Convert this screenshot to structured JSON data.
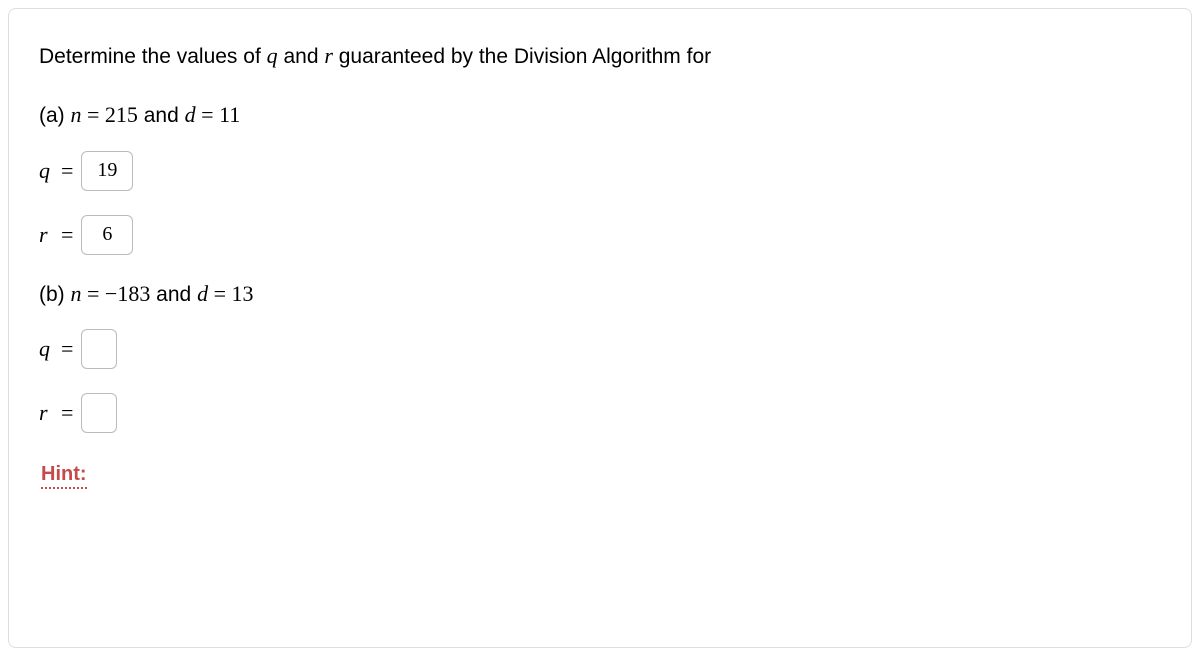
{
  "prompt": {
    "prefix": "Determine the values of ",
    "var_q": "q",
    "and1": " and ",
    "var_r": "r",
    "suffix": " guaranteed by the Division Algorithm for"
  },
  "partA": {
    "label": "(a) ",
    "var_n": "n",
    "eq1": " = ",
    "n_val": "215",
    "and_text": " and ",
    "var_d": "d",
    "eq2": " = ",
    "d_val": "11",
    "q_label": "q",
    "q_equals": "=",
    "q_value": "19",
    "r_label": "r",
    "r_equals": "=",
    "r_value": "6"
  },
  "partB": {
    "label": "(b) ",
    "var_n": "n",
    "eq1": " = ",
    "n_neg": "−",
    "n_val": "183",
    "and_text": " and ",
    "var_d": "d",
    "eq2": " = ",
    "d_val": "13",
    "q_label": "q",
    "q_equals": "=",
    "q_value": "",
    "r_label": "r",
    "r_equals": "=",
    "r_value": ""
  },
  "hint": {
    "label": "Hint:"
  }
}
